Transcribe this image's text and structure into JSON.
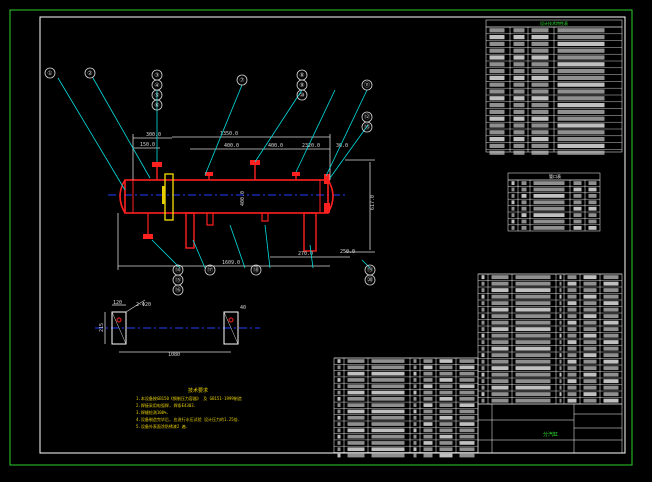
{
  "colors": {
    "background": "#000000",
    "frame": "#2bd12b",
    "vessel": "#ff2020",
    "dimension": "#d8d8d8",
    "leader": "#00e0e0",
    "table": "#ffffff",
    "accent_yellow": "#e8d000",
    "centerline": "#2040ff",
    "text_green": "#30e030",
    "label_magenta": "#ff40ff"
  },
  "dimensions": {
    "d_300": "300.0",
    "d_1350": "1350.0",
    "d_150_l": "150.0",
    "d_400_a": "400.0",
    "d_400_b": "400.0",
    "d_400_c": "400.0",
    "d_2320": "2320.0",
    "d_30": "30.0",
    "d_1609": "1609.0",
    "d_270": "270.0",
    "d_250": "250.0",
    "d_617": "617.0",
    "d_1080": "1080",
    "d_120": "120",
    "d_2_phi": "2-Φ20",
    "d_40": "40",
    "d_215": "215"
  },
  "balloons_top": [
    "①",
    "②",
    "③",
    "④",
    "⑤",
    "⑥",
    "⑦",
    "⑧",
    "⑨",
    "⑩",
    "⑪",
    "⑫",
    "⑬"
  ],
  "balloons_bottom": [
    "⑭",
    "⑮",
    "⑯",
    "⑰",
    "⑱",
    "⑲",
    "⑳"
  ],
  "notes": {
    "heading": "技术要求",
    "lines": [
      "1.本设备按GB150《钢制压力容器》 及 GB151-1999制造",
      "2.焊接采用电弧焊, 焊条E4303.",
      "3.焊缝检测100%.",
      "4.设备制造完毕后, 应进行水压试验 设计压力的1.25倍.",
      "5.设备外表面涂防锈漆2 遍."
    ]
  },
  "design_table": {
    "title": "设计技术特性表"
  },
  "nozzle_table": {
    "title": "管口表"
  },
  "title_block": {
    "name": "分汽缸"
  }
}
